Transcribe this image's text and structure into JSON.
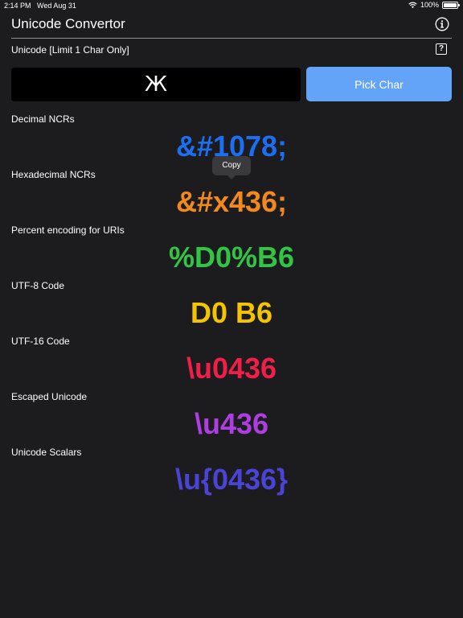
{
  "status_bar": {
    "time": "2:14 PM",
    "date": "Wed Aug 31",
    "battery": "100%"
  },
  "header": {
    "title": "Unicode Convertor",
    "info_icon": "info-circle-icon"
  },
  "input": {
    "label": "Unicode [Limit 1 Char Only]",
    "help_icon": "question-square-icon",
    "help_glyph": "?",
    "value": "Ж",
    "pick_button_label": "Pick Char"
  },
  "tooltip": {
    "label": "Copy"
  },
  "results": [
    {
      "label": "Decimal NCRs",
      "value": "&#1078;",
      "color": "#1c6ef2"
    },
    {
      "label": "Hexadecimal NCRs",
      "value": "&#x436;",
      "color": "#f2891e"
    },
    {
      "label": "Percent encoding for URIs",
      "value": "%D0%B6",
      "color": "#32c545"
    },
    {
      "label": "UTF-8 Code",
      "value": "D0 B6",
      "color": "#f5c400"
    },
    {
      "label": "UTF-16 Code",
      "value": "\\u0436",
      "color": "#f01f4a"
    },
    {
      "label": "Escaped Unicode",
      "value": "\\u436",
      "color": "#ad3fe0"
    },
    {
      "label": "Unicode Scalars",
      "value": "\\u{0436}",
      "color": "#4a44d6"
    }
  ],
  "colors": {
    "background": "#1c1c1e",
    "accent": "#63a4f9",
    "input_background": "#000000"
  }
}
